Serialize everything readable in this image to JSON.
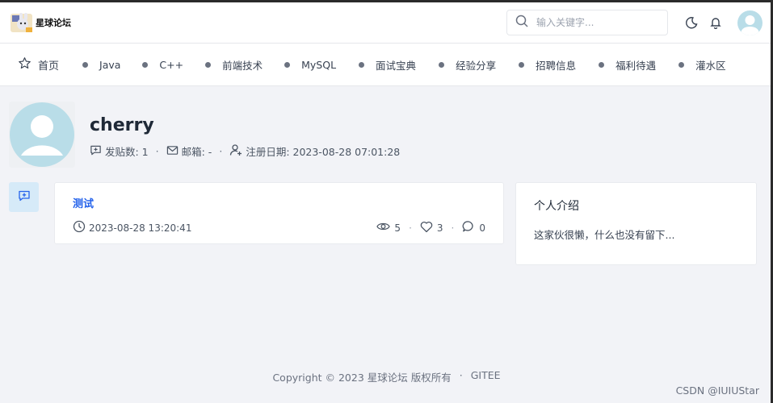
{
  "header": {
    "brand": "星球论坛",
    "search_placeholder": "输入关键字..."
  },
  "nav": {
    "home": "首页",
    "items": [
      "Java",
      "C++",
      "前端技术",
      "MySQL",
      "面试宝典",
      "经验分享",
      "招聘信息",
      "福利待遇",
      "灌水区"
    ]
  },
  "profile": {
    "username": "cherry",
    "posts_label": "发贴数: 1",
    "email_label": "邮箱: -",
    "register_label": "注册日期: 2023-08-28 07:01:28"
  },
  "post": {
    "title": "测试",
    "date": "2023-08-28 13:20:41",
    "views": "5",
    "likes": "3",
    "comments": "0"
  },
  "intro": {
    "title": "个人介绍",
    "text": "这家伙很懒，什么也没有留下..."
  },
  "footer": {
    "copyright": "Copyright © 2023 星球论坛 版权所有",
    "sep": "·",
    "gitee": "GITEE"
  },
  "watermark": "CSDN @IUIUStar",
  "colors": {
    "accent": "#2563eb",
    "avatar_bg": "#b9dde8",
    "tab_bg": "#d6eaf8"
  }
}
